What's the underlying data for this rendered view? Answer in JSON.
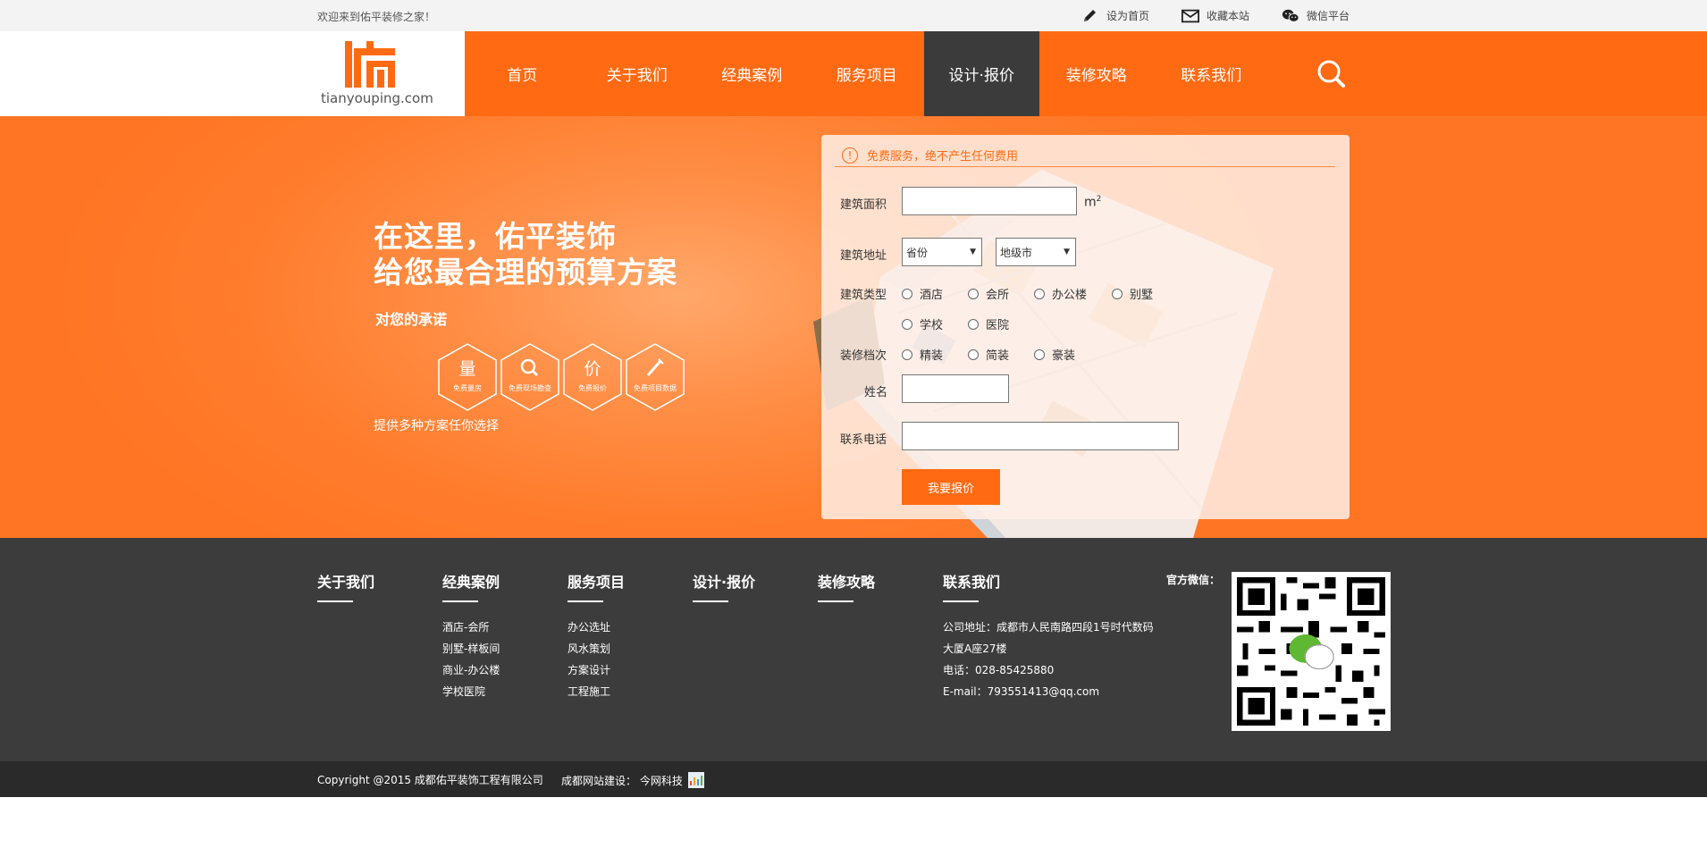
{
  "topbar": {
    "welcome": "欢迎来到佑平装修之家！",
    "links": [
      {
        "label": "设为首页",
        "icon": "pencil-icon"
      },
      {
        "label": "收藏本站",
        "icon": "mail-icon"
      },
      {
        "label": "微信平台",
        "icon": "wechat-icon"
      }
    ]
  },
  "header": {
    "logo_text": "tianyouping.com",
    "nav": [
      "首页",
      "关于我们",
      "经典案例",
      "服务项目",
      "设计·报价",
      "装修攻略",
      "联系我们"
    ],
    "active_index": 4
  },
  "hero": {
    "title_line1": "在这里，佑平装饰",
    "title_line2": "给您最合理的预算方案",
    "subtitle": "对您的承诺",
    "promises": [
      {
        "char": "量",
        "label": "免费量房"
      },
      {
        "char": "",
        "label": "免费现场勘查",
        "icon": "magnifier-icon"
      },
      {
        "char": "价",
        "label": "免费报价"
      },
      {
        "char": "",
        "label": "免费项目数据",
        "icon": "pen-icon"
      }
    ],
    "note": "提供多种方案任你选择"
  },
  "form": {
    "notice": "免费服务，绝不产生任何费用",
    "area_label": "建筑面积",
    "area_unit": "m",
    "area_unit_sup": "2",
    "address_label": "建筑地址",
    "province_value": "省份",
    "city_value": "地级市",
    "type_label": "建筑类型",
    "types": [
      "酒店",
      "会所",
      "办公楼",
      "别墅",
      "学校",
      "医院"
    ],
    "grade_label": "装修档次",
    "grades": [
      "精装",
      "简装",
      "豪装"
    ],
    "name_label": "姓名",
    "phone_label": "联系电话",
    "submit": "我要报价"
  },
  "footer": {
    "columns": [
      {
        "title": "关于我们",
        "links": []
      },
      {
        "title": "经典案例",
        "links": [
          "酒店-会所",
          "别墅-样板间",
          "商业-办公楼",
          "学校医院"
        ]
      },
      {
        "title": "服务项目",
        "links": [
          "办公选址",
          "风水策划",
          "方案设计",
          "工程施工"
        ]
      },
      {
        "title": "设计·报价",
        "links": []
      },
      {
        "title": "装修攻略",
        "links": []
      }
    ],
    "contact": {
      "title": "联系我们",
      "lines": [
        "公司地址：成都市人民南路四段1号时代数码",
        "大厦A座27楼",
        "电话：028-85425880",
        "E-mail：793551413@qq.com"
      ]
    },
    "wechat_label": "官方微信：",
    "copyright": "Copyright @2015 成都佑平装饰工程有限公司",
    "builder": "成都网站建设： 今网科技"
  },
  "colors": {
    "accent": "#ff6a13",
    "dark": "#3c3c3c",
    "darker": "#2a2a2a"
  }
}
